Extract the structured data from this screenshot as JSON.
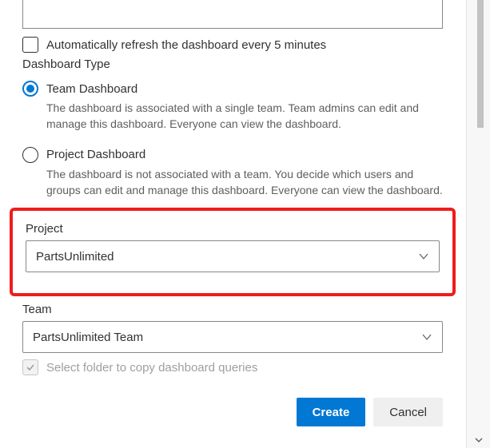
{
  "autoRefresh": {
    "label": "Automatically refresh the dashboard every 5 minutes"
  },
  "dashboardTypeLabel": "Dashboard Type",
  "options": {
    "team": {
      "label": "Team Dashboard",
      "description": "The dashboard is associated with a single team. Team admins can edit and manage this dashboard. Everyone can view the dashboard."
    },
    "project": {
      "label": "Project Dashboard",
      "description": "The dashboard is not associated with a team. You decide which users and groups can edit and manage this dashboard. Everyone can view the dashboard."
    }
  },
  "project": {
    "label": "Project",
    "value": "PartsUnlimited"
  },
  "team": {
    "label": "Team",
    "value": "PartsUnlimited Team"
  },
  "copyQueries": {
    "label": "Select folder to copy dashboard queries"
  },
  "buttons": {
    "create": "Create",
    "cancel": "Cancel"
  }
}
